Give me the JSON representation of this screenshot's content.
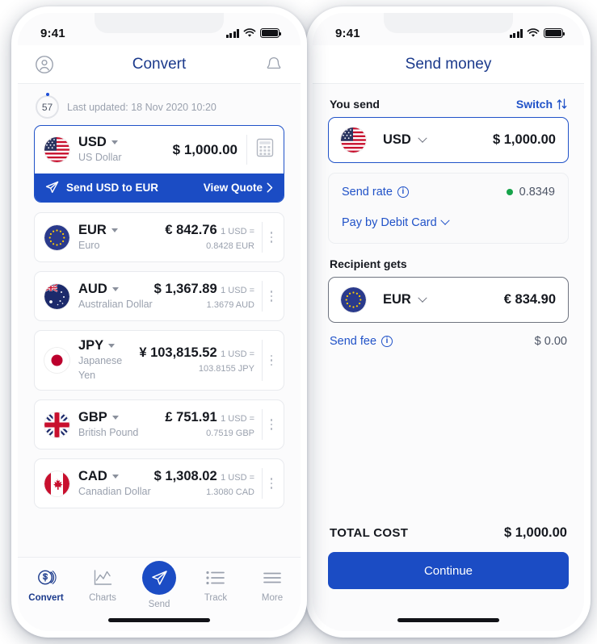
{
  "left_phone": {
    "status_bar": {
      "time": "9:41",
      "signal": "signal-bars",
      "wifi": "wifi",
      "battery": "battery-full"
    },
    "header": {
      "title": "Convert",
      "avatar_icon": "account-circle-icon",
      "bell_icon": "notification-bell-icon"
    },
    "refresh": {
      "seconds": "57",
      "updated_text": "Last updated: 18 Nov 2020 10:20"
    },
    "base_currency": {
      "code": "USD",
      "name": "US Dollar",
      "amount": "$ 1,000.00",
      "flag": "flag-us",
      "calculator_icon": "calculator-icon",
      "banner_label": "Send USD to EUR",
      "banner_action": "View Quote",
      "banner_chevron": "chevron-right-icon",
      "send_icon": "send-plane-icon"
    },
    "currencies": [
      {
        "code": "EUR",
        "name": "Euro",
        "amount": "€ 842.76",
        "rate_line1": "1 USD =",
        "rate_line2": "0.8428 EUR",
        "flag": "flag-eu"
      },
      {
        "code": "AUD",
        "name": "Australian Dollar",
        "amount": "$ 1,367.89",
        "rate_line1": "1 USD =",
        "rate_line2": "1.3679 AUD",
        "flag": "flag-au"
      },
      {
        "code": "JPY",
        "name": "Japanese Yen",
        "amount": "¥ 103,815.52",
        "rate_line1": "1 USD =",
        "rate_line2": "103.8155 JPY",
        "flag": "flag-jp"
      },
      {
        "code": "GBP",
        "name": "British Pound",
        "amount": "£ 751.91",
        "rate_line1": "1 USD =",
        "rate_line2": "0.7519 GBP",
        "flag": "flag-gb"
      },
      {
        "code": "CAD",
        "name": "Canadian Dollar",
        "amount": "$ 1,308.02",
        "rate_line1": "1 USD =",
        "rate_line2": "1.3080 CAD",
        "flag": "flag-ca"
      }
    ],
    "tabs": [
      {
        "label": "Convert",
        "icon": "coin-dollar-icon",
        "active": true
      },
      {
        "label": "Charts",
        "icon": "line-chart-icon",
        "active": false
      },
      {
        "label": "Send",
        "icon": "send-plane-icon",
        "active": false
      },
      {
        "label": "Track",
        "icon": "list-icon",
        "active": false
      },
      {
        "label": "More",
        "icon": "menu-lines-icon",
        "active": false
      }
    ]
  },
  "right_phone": {
    "status_bar": {
      "time": "9:41"
    },
    "header": {
      "title": "Send money"
    },
    "you_send": {
      "label": "You send",
      "switch_label": "Switch",
      "switch_icon": "switch-arrows-icon",
      "code": "USD",
      "flag": "flag-us",
      "value": "$ 1,000.00"
    },
    "rate_card": {
      "send_rate_label": "Send rate",
      "send_rate_value": "0.8349",
      "status_dot_color": "#16a34a",
      "payment_method": "Pay by Debit Card"
    },
    "recipient": {
      "label": "Recipient gets",
      "code": "EUR",
      "flag": "flag-eu",
      "value": "€ 834.90"
    },
    "send_fee": {
      "label": "Send fee",
      "value": "$ 0.00"
    },
    "total": {
      "label": "TOTAL COST",
      "value": "$ 1,000.00"
    },
    "continue_label": "Continue"
  },
  "colors": {
    "brand_blue": "#1b4cc4",
    "title_blue": "#1b3a8c",
    "link_blue": "#2052c8",
    "green": "#16a34a"
  }
}
